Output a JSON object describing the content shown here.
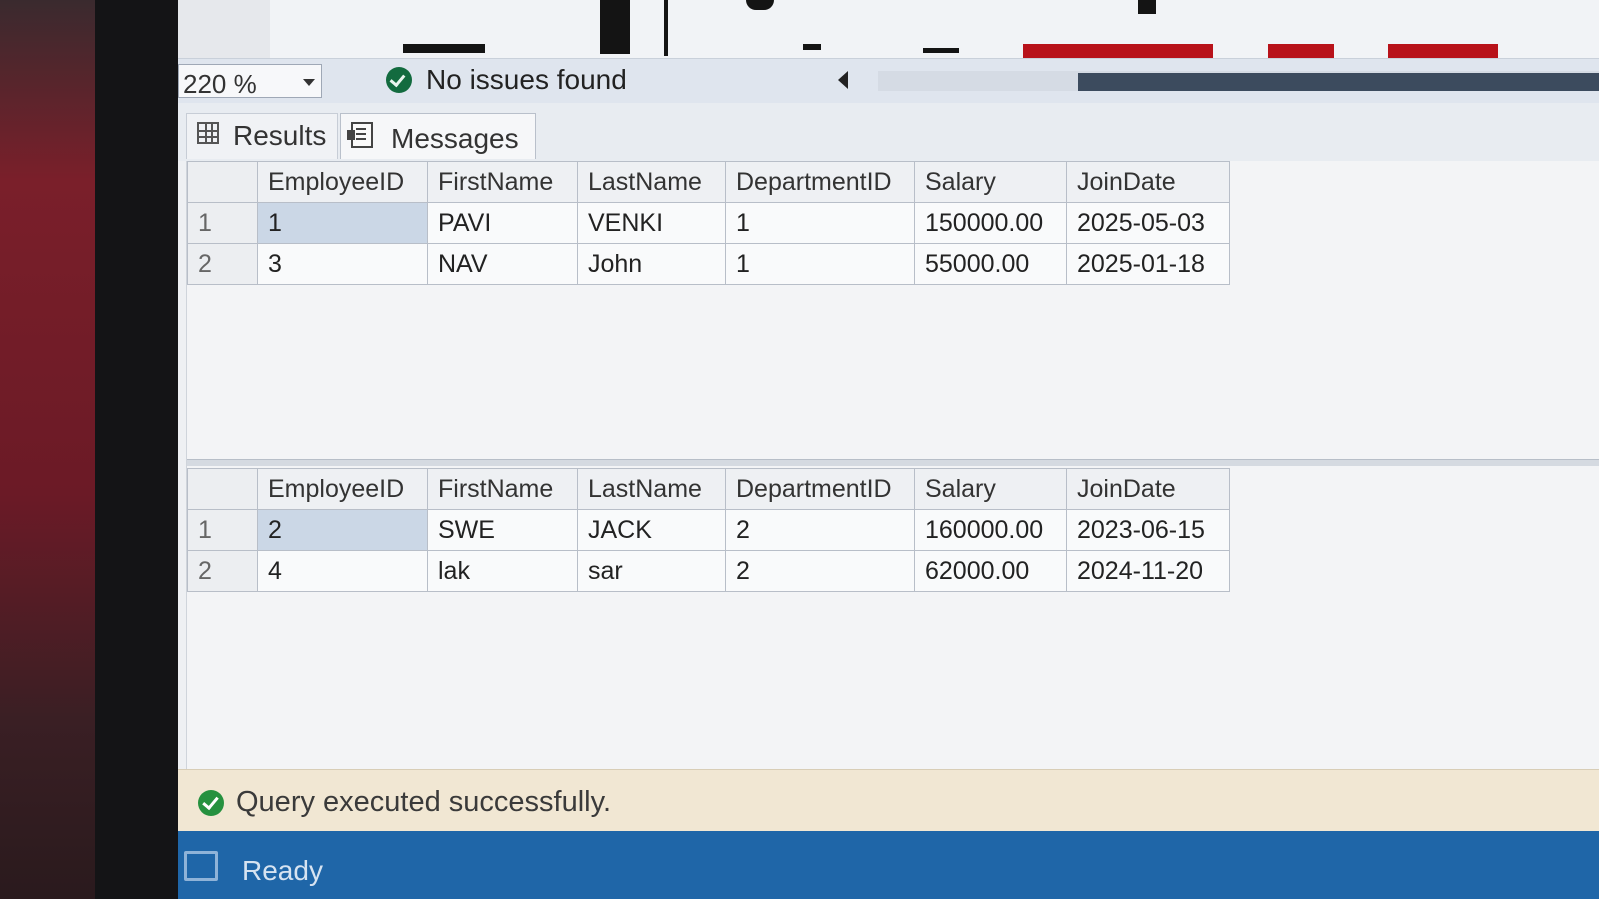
{
  "toolbar": {
    "zoom_value": "220 %",
    "issues_text": "No issues found"
  },
  "tabs": [
    {
      "label": "Results",
      "icon": "grid-icon"
    },
    {
      "label": "Messages",
      "icon": "messages-icon"
    }
  ],
  "results": [
    {
      "columns": [
        "EmployeeID",
        "FirstName",
        "LastName",
        "DepartmentID",
        "Salary",
        "JoinDate"
      ],
      "rows": [
        {
          "num": "1",
          "cells": [
            "1",
            "PAVI",
            "VENKI",
            "1",
            "150000.00",
            "2025-05-03"
          ]
        },
        {
          "num": "2",
          "cells": [
            "3",
            "NAV",
            "John",
            "1",
            "55000.00",
            "2025-01-18"
          ]
        }
      ]
    },
    {
      "columns": [
        "EmployeeID",
        "FirstName",
        "LastName",
        "DepartmentID",
        "Salary",
        "JoinDate"
      ],
      "rows": [
        {
          "num": "1",
          "cells": [
            "2",
            "SWE",
            "JACK",
            "2",
            "160000.00",
            "2023-06-15"
          ]
        },
        {
          "num": "2",
          "cells": [
            "4",
            "lak",
            "sar",
            "2",
            "62000.00",
            "2024-11-20"
          ]
        }
      ]
    }
  ],
  "status": {
    "message": "Query executed successfully.",
    "ready": "Ready"
  },
  "colors": {
    "status_bar": "#f1e7d3",
    "ready_bar": "#1f66a8",
    "success": "#26913f",
    "selected_cell": "#cbd7e6"
  }
}
